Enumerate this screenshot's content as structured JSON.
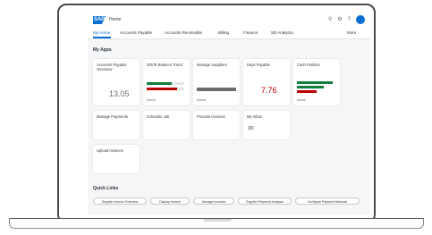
{
  "shell": {
    "title": "Home"
  },
  "nav": {
    "tabs": [
      {
        "label": "My Home"
      },
      {
        "label": "Accounts Payable"
      },
      {
        "label": "Accounts Receivable"
      },
      {
        "label": "Billing"
      },
      {
        "label": "Finance"
      },
      {
        "label": "SD Analytics"
      },
      {
        "label": "More"
      }
    ]
  },
  "sections": {
    "apps": "My Apps",
    "links": "Quick Links"
  },
  "tiles": [
    {
      "title": "Accounts Payable Overview",
      "subtitle": "",
      "value": "13.05",
      "footer": ""
    },
    {
      "title": "GR/IR Balance Trend",
      "subtitle": "",
      "value": "",
      "footer": "Actual"
    },
    {
      "title": "Manage Suppliers",
      "subtitle": "",
      "value": "",
      "footer": "Actual"
    },
    {
      "title": "Days Payable",
      "subtitle": "",
      "value": "7.76",
      "footer": ""
    },
    {
      "title": "Cash Position",
      "subtitle": "",
      "value": "",
      "footer": "Actual"
    },
    {
      "title": "Manage Payments",
      "subtitle": "",
      "value": "",
      "footer": ""
    },
    {
      "title": "Schedule Job",
      "subtitle": "",
      "value": "",
      "footer": ""
    },
    {
      "title": "Process Invoices",
      "subtitle": "",
      "value": "",
      "footer": ""
    },
    {
      "title": "My Inbox",
      "subtitle": "",
      "value": "",
      "footer": ""
    },
    {
      "title": "Upload Invoices",
      "subtitle": "",
      "value": "",
      "footer": ""
    }
  ],
  "links": [
    {
      "label": "Supplier Invoice Overview"
    },
    {
      "label": "Display Invoice"
    },
    {
      "label": "Manage Invoices"
    },
    {
      "label": "Supplier Payment Analysis"
    },
    {
      "label": "Configure Payment Methods"
    }
  ],
  "colors": {
    "accent": "#0a6ed1",
    "negative": "#bb0000",
    "positive": "#107e3e"
  }
}
